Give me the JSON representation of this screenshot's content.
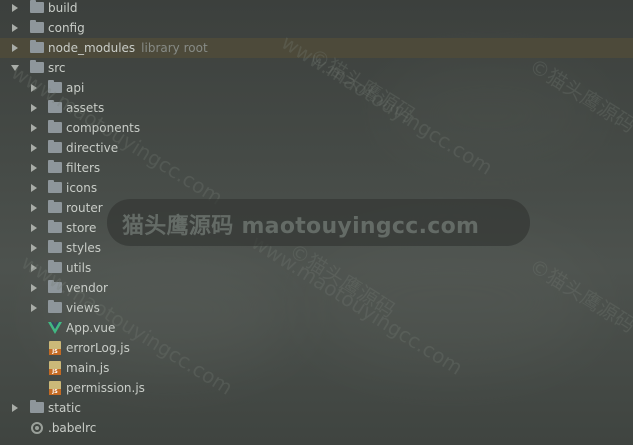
{
  "tree": {
    "items": [
      {
        "label": "build",
        "hint": "",
        "type": "folder",
        "state": "collapsed"
      },
      {
        "label": "config",
        "hint": "",
        "type": "folder",
        "state": "collapsed"
      },
      {
        "label": "node_modules",
        "hint": "library root",
        "type": "folder",
        "state": "collapsed"
      },
      {
        "label": "src",
        "hint": "",
        "type": "folder",
        "state": "expanded"
      },
      {
        "label": "api",
        "hint": "",
        "type": "folder",
        "state": "collapsed"
      },
      {
        "label": "assets",
        "hint": "",
        "type": "folder",
        "state": "collapsed"
      },
      {
        "label": "components",
        "hint": "",
        "type": "folder",
        "state": "collapsed"
      },
      {
        "label": "directive",
        "hint": "",
        "type": "folder",
        "state": "collapsed"
      },
      {
        "label": "filters",
        "hint": "",
        "type": "folder",
        "state": "collapsed"
      },
      {
        "label": "icons",
        "hint": "",
        "type": "folder",
        "state": "collapsed"
      },
      {
        "label": "router",
        "hint": "",
        "type": "folder",
        "state": "collapsed"
      },
      {
        "label": "store",
        "hint": "",
        "type": "folder",
        "state": "collapsed"
      },
      {
        "label": "styles",
        "hint": "",
        "type": "folder",
        "state": "collapsed"
      },
      {
        "label": "utils",
        "hint": "",
        "type": "folder",
        "state": "collapsed"
      },
      {
        "label": "vendor",
        "hint": "",
        "type": "folder",
        "state": "collapsed"
      },
      {
        "label": "views",
        "hint": "",
        "type": "folder",
        "state": "collapsed"
      },
      {
        "label": "App.vue",
        "hint": "",
        "type": "vue-file",
        "state": ""
      },
      {
        "label": "errorLog.js",
        "hint": "",
        "type": "js-file",
        "state": ""
      },
      {
        "label": "main.js",
        "hint": "",
        "type": "js-file",
        "state": ""
      },
      {
        "label": "permission.js",
        "hint": "",
        "type": "js-file",
        "state": ""
      },
      {
        "label": "static",
        "hint": "",
        "type": "folder",
        "state": "collapsed"
      },
      {
        "label": ".babelrc",
        "hint": "",
        "type": "config-file",
        "state": ""
      }
    ],
    "js_badge": "JS"
  },
  "watermark": {
    "banner_text": "猫头鹰源码 maotouyingcc.com",
    "diagonal_text": "www.maotouyingcc.com",
    "diagonal_text_cn": "©猫头鹰源码"
  },
  "colors": {
    "background": "#404541",
    "text": "#c9cdc8",
    "hint_text": "#878b86",
    "folder_icon": "#8e969b",
    "highlight_row": "#4d4a3a",
    "vue_green": "#41b883",
    "js_yellow": "#cbb979"
  }
}
